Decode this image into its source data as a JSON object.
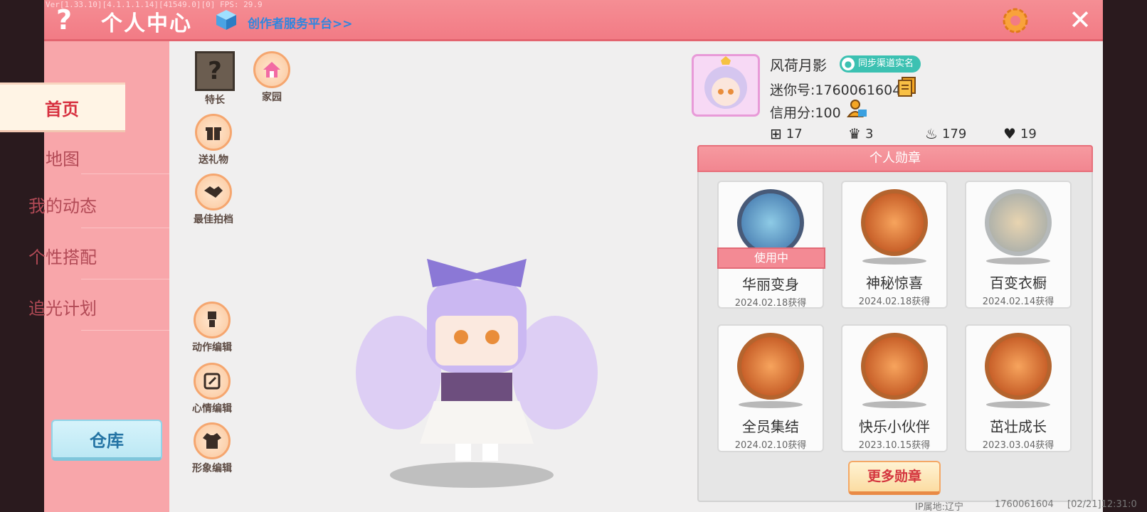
{
  "debug": {
    "version": "Ver[1.33.10][4.1.1.1.14][41549.0][0] FPS: 29.9"
  },
  "header": {
    "title": "个人中心",
    "creator_link": "创作者服务平台>>"
  },
  "sidebar": {
    "items": [
      {
        "label": "首页",
        "active": true
      },
      {
        "label": "地图"
      },
      {
        "label": "我的动态"
      },
      {
        "label": "个性搭配"
      },
      {
        "label": "追光计划"
      }
    ],
    "warehouse_label": "仓库"
  },
  "actions": {
    "specialty": "特长",
    "home": "家园",
    "gift": "送礼物",
    "partner": "最佳拍档",
    "action_edit": "动作编辑",
    "mood_edit": "心情编辑",
    "look_edit": "形象编辑"
  },
  "profile": {
    "name": "风荷月影",
    "realname_tag": "同步渠道实名",
    "mini_id": "迷你号:1760061604",
    "credit": "信用分:100",
    "stats": {
      "adds": "17",
      "fans": "3",
      "heat": "179",
      "likes": "19"
    }
  },
  "badges": {
    "title": "个人勋章",
    "in_use_label": "使用中",
    "items": [
      {
        "name": "华丽变身",
        "date": "2024.02.18获得"
      },
      {
        "name": "神秘惊喜",
        "date": "2024.02.18获得"
      },
      {
        "name": "百变衣橱",
        "date": "2024.02.14获得"
      },
      {
        "name": "全员集结",
        "date": "2024.02.10获得"
      },
      {
        "name": "快乐小伙伴",
        "date": "2023.10.15获得"
      },
      {
        "name": "茁壮成长",
        "date": "2023.03.04获得"
      }
    ],
    "more_label": "更多勋章"
  },
  "footer": {
    "ip": "IP属地:辽宁",
    "uid": "1760061604",
    "time": "[02/21]12:31:0"
  }
}
